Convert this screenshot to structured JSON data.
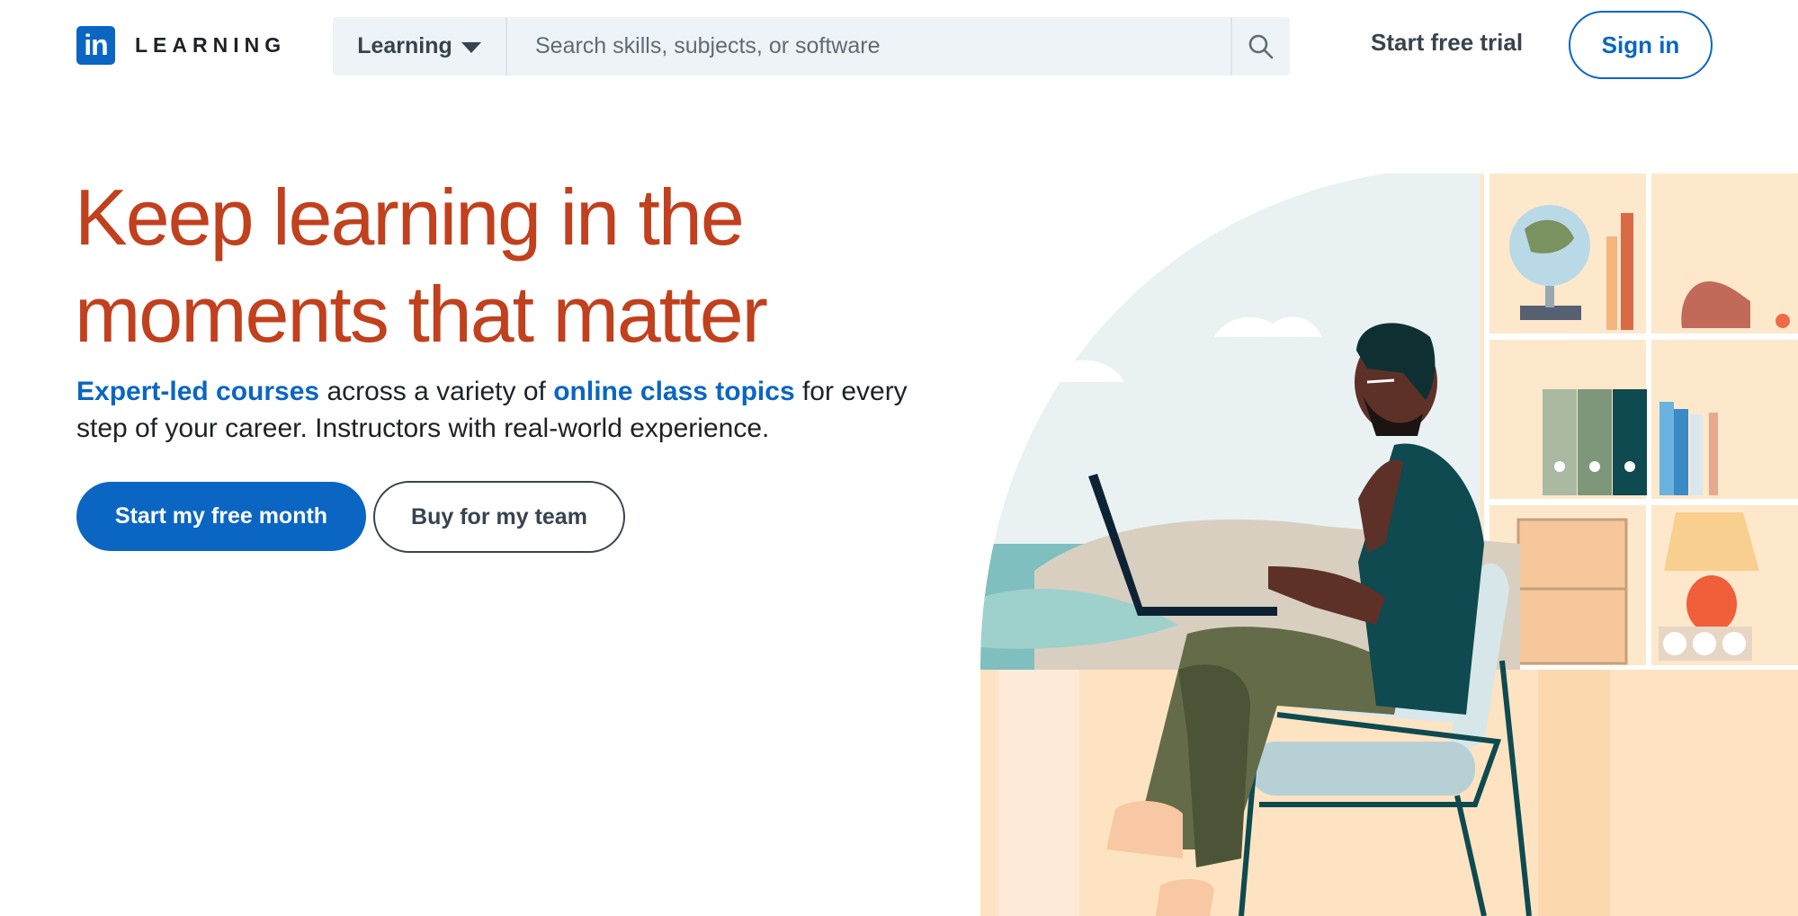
{
  "header": {
    "logo_mark": "in",
    "logo_word": "LEARNING",
    "search_scope": "Learning",
    "search_placeholder": "Search skills, subjects, or software",
    "search_icon": "search-icon",
    "trial_link": "Start free trial",
    "signin_label": "Sign in"
  },
  "hero": {
    "headline": "Keep learning in the moments that matter",
    "sub_link1": "Expert-led courses",
    "sub_text1": " across a variety of ",
    "sub_link2": "online class topics",
    "sub_text2": " for every step of your career. Instructors with real-world experience.",
    "cta_primary": "Start my free month",
    "cta_secondary": "Buy for my team",
    "illustration_icon": "person-with-laptop-illustration"
  },
  "colors": {
    "brand_blue": "#0a66c2",
    "headline_orange": "#c1401d",
    "search_bg": "#eef3f8"
  }
}
